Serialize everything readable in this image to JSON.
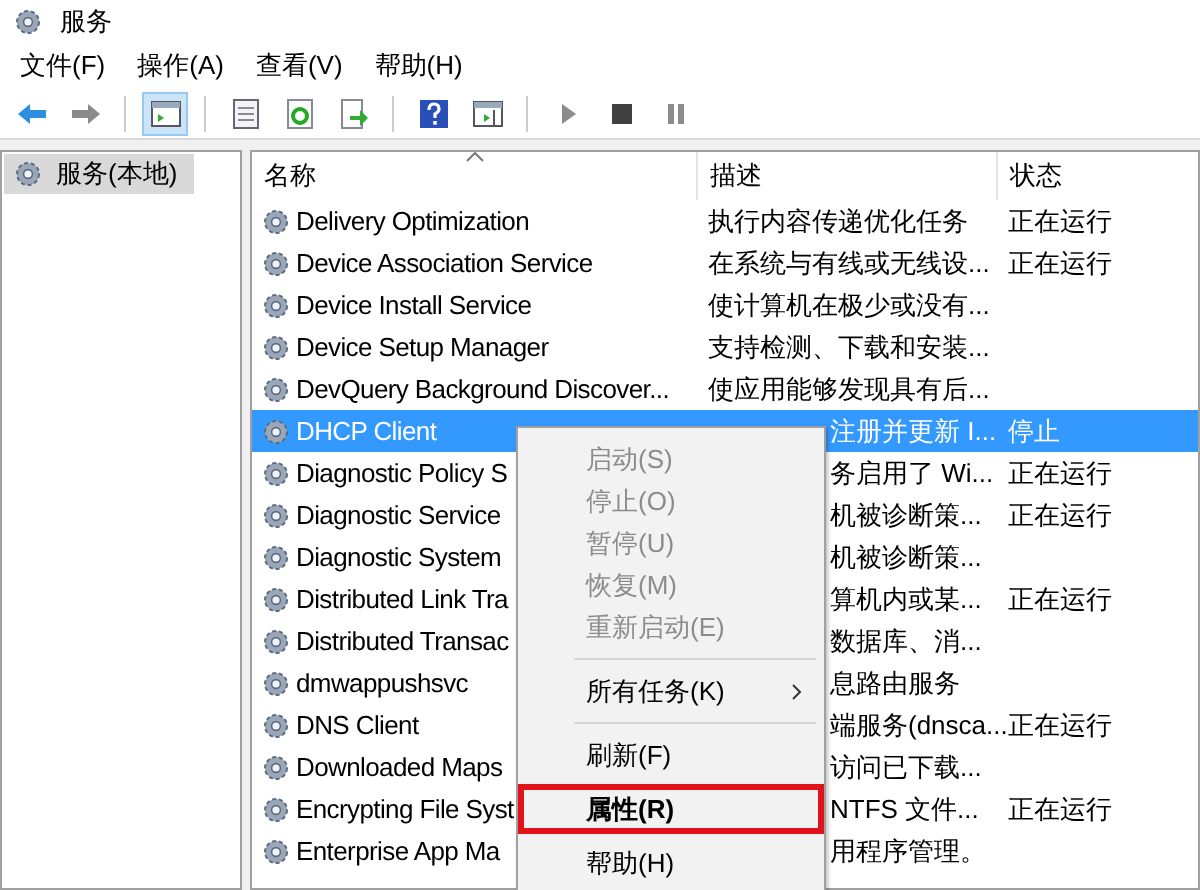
{
  "window": {
    "title": "服务"
  },
  "menu_bar": [
    "文件(F)",
    "操作(A)",
    "查看(V)",
    "帮助(H)"
  ],
  "toolbar": [
    {
      "kind": "back",
      "selected": false
    },
    {
      "kind": "forward",
      "selected": false
    },
    {
      "kind": "tree",
      "selected": true
    },
    {
      "kind": "properties",
      "selected": false
    },
    {
      "kind": "refresh",
      "selected": false
    },
    {
      "kind": "export",
      "selected": false
    },
    {
      "kind": "help",
      "selected": false
    },
    {
      "kind": "pane",
      "selected": false
    },
    {
      "kind": "play",
      "selected": false
    },
    {
      "kind": "stop",
      "selected": false
    },
    {
      "kind": "pause",
      "selected": false
    }
  ],
  "tree": [
    {
      "label": "服务(本地)",
      "selected": true
    }
  ],
  "table": {
    "columns": [
      "名称",
      "描述",
      "状态"
    ],
    "rows": [
      {
        "name": "Delivery Optimization",
        "description": "执行内容传递优化任务",
        "status": "正在运行",
        "selected": false
      },
      {
        "name": "Device Association Service",
        "description": "在系统与有线或无线设...",
        "status": "正在运行",
        "selected": false
      },
      {
        "name": "Device Install Service",
        "description": "使计算机在极少或没有...",
        "status": "",
        "selected": false
      },
      {
        "name": "Device Setup Manager",
        "description": "支持检测、下载和安装...",
        "status": "",
        "selected": false
      },
      {
        "name": "DevQuery Background Discover...",
        "description": "使应用能够发现具有后...",
        "status": "",
        "selected": false
      },
      {
        "name": "DHCP Client",
        "description": "注册并更新 I...",
        "status": "停止",
        "selected": true
      },
      {
        "name": "Diagnostic Policy S",
        "description": "务启用了 Wi...",
        "status": "正在运行",
        "selected": false
      },
      {
        "name": "Diagnostic Service",
        "description": "机被诊断策...",
        "status": "正在运行",
        "selected": false
      },
      {
        "name": "Diagnostic System",
        "description": "机被诊断策...",
        "status": "",
        "selected": false
      },
      {
        "name": "Distributed Link Tra",
        "description": "算机内或某...",
        "status": "正在运行",
        "selected": false
      },
      {
        "name": "Distributed Transac",
        "description": "数据库、消...",
        "status": "",
        "selected": false
      },
      {
        "name": "dmwappushsvc",
        "description": "息路由服务",
        "status": "",
        "selected": false
      },
      {
        "name": "DNS Client",
        "description": "端服务(dnsca...",
        "status": "正在运行",
        "selected": false
      },
      {
        "name": "Downloaded Maps",
        "description": "访问已下载...",
        "status": "",
        "selected": false
      },
      {
        "name": "Encrypting File Syst",
        "description": "NTFS 文件...",
        "status": "正在运行",
        "selected": false
      },
      {
        "name": "Enterprise App Ma",
        "description": "用程序管理。",
        "status": "",
        "selected": false
      }
    ]
  },
  "context_menu": [
    {
      "kind": "item",
      "label": "启动(S)",
      "disabled": true,
      "emphasized": false
    },
    {
      "kind": "item",
      "label": "停止(O)",
      "disabled": true,
      "emphasized": false
    },
    {
      "kind": "item",
      "label": "暂停(U)",
      "disabled": true,
      "emphasized": false
    },
    {
      "kind": "item",
      "label": "恢复(M)",
      "disabled": true,
      "emphasized": false
    },
    {
      "kind": "item",
      "label": "重新启动(E)",
      "disabled": true,
      "emphasized": false
    },
    {
      "kind": "separator"
    },
    {
      "kind": "submenu",
      "label": "所有任务(K)",
      "disabled": false,
      "emphasized": false
    },
    {
      "kind": "separator"
    },
    {
      "kind": "item",
      "label": "刷新(F)",
      "disabled": false,
      "emphasized": false
    },
    {
      "kind": "item",
      "label": "属性(R)",
      "disabled": false,
      "emphasized": true
    },
    {
      "kind": "item",
      "label": "帮助(H)",
      "disabled": false,
      "emphasized": false
    }
  ]
}
